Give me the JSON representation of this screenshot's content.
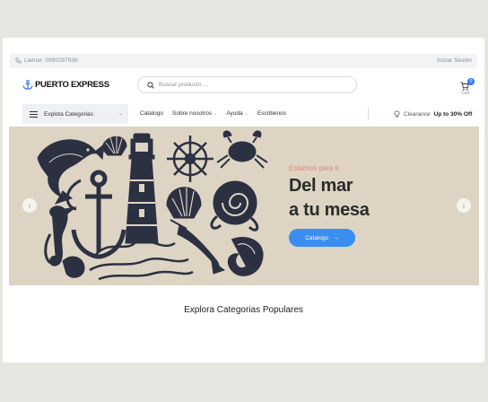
{
  "topbar": {
    "call_label": "Llamar: 0990287938",
    "login_label": "Iniciar Sesión"
  },
  "header": {
    "brand": "PUERTO EXPRESS",
    "search": {
      "placeholder": "Buscar producto ...",
      "value": ""
    },
    "cart_label": "Cart",
    "cart_count": "0"
  },
  "nav": {
    "categories_label": "Explota Categorias",
    "items": [
      {
        "label": "Catalogo",
        "has_dropdown": false
      },
      {
        "label": "Sobre nosotros",
        "has_dropdown": true
      },
      {
        "label": "Ayuda",
        "has_dropdown": true
      },
      {
        "label": "Escribenos",
        "has_dropdown": false
      }
    ],
    "clearance": {
      "prefix": "Clearance",
      "highlight": "Up to 30% Off"
    }
  },
  "hero": {
    "kicker": "Estamos para ti",
    "headline_line1": "Del mar",
    "headline_line2": "a tu mesa",
    "cta_label": "Catalogo",
    "prev_icon": "chevron-left-icon",
    "next_icon": "chevron-right-icon",
    "illustration": "vintage nautical engravings: fish, shell, ship wheel, crab, anchor, lighthouse, seahorse, octopus, swordfish, salmon steak"
  },
  "section_title": "Explora Categorias Populares",
  "colors": {
    "accent": "#3a8ef2",
    "hero_bg": "#ddd4c3",
    "kicker": "#e08672",
    "ink": "#2c3142"
  }
}
